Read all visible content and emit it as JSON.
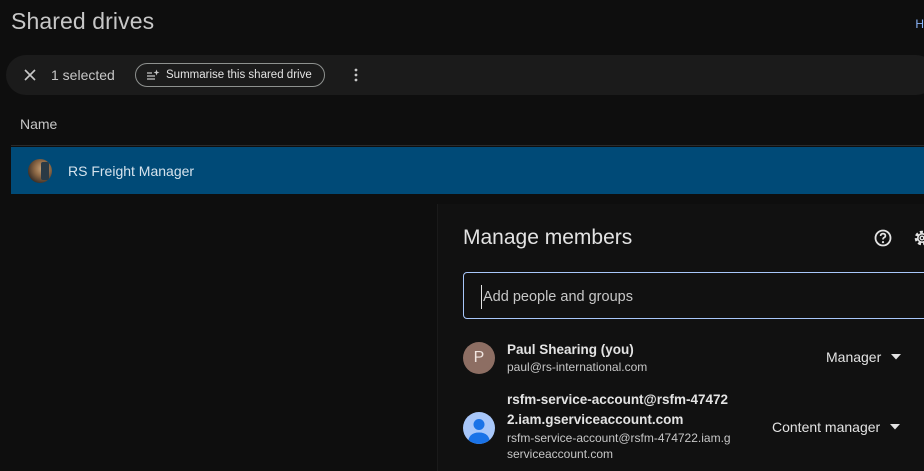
{
  "page": {
    "title": "Shared drives",
    "corner_link": "H"
  },
  "selection_bar": {
    "selected_text": "1 selected",
    "summarise_label": "Summarise this shared drive"
  },
  "table": {
    "name_header": "Name",
    "rows": [
      {
        "name": "RS Freight Manager"
      }
    ]
  },
  "dialog": {
    "title": "Manage members",
    "search_placeholder": "Add people and groups",
    "members": [
      {
        "initial": "P",
        "name": "Paul Shearing (you)",
        "email": "paul@rs-international.com",
        "role": "Manager",
        "avatar_color": "#8d6e63"
      },
      {
        "name_line1": "rsfm-service-account@rsfm-47472",
        "name_line2": "2.iam.gserviceaccount.com",
        "email_line1": "rsfm-service-account@rsfm-474722.iam.g",
        "email_line2": "serviceaccount.com",
        "role": "Content manager",
        "avatar_color": "#a8c7fa"
      }
    ]
  },
  "icons": {
    "close": "close-icon",
    "summarise": "sparkle-list-icon",
    "more": "more-vert-icon",
    "help": "help-circle-icon",
    "settings": "gear-icon",
    "dropdown": "arrow-drop-down-icon",
    "person": "person-icon"
  },
  "colors": {
    "background": "#0e0e0e",
    "selected_row": "#004a77",
    "accent": "#a8c7fa"
  }
}
